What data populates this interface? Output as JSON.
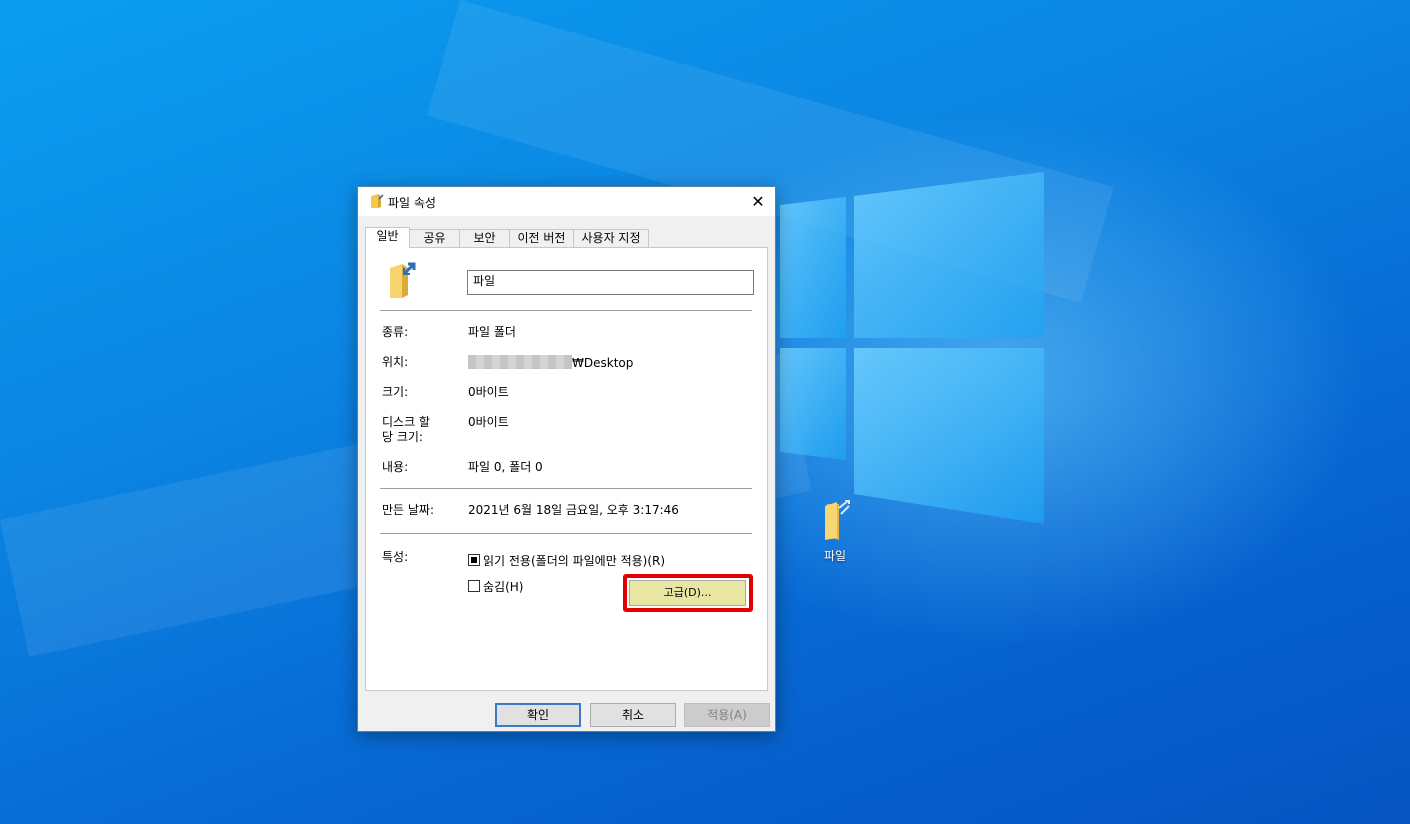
{
  "dialog": {
    "title": "파일 속성",
    "close_label": "✕",
    "tabs": [
      {
        "label": "일반"
      },
      {
        "label": "공유"
      },
      {
        "label": "보안"
      },
      {
        "label": "이전 버전"
      },
      {
        "label": "사용자 지정"
      }
    ],
    "name_value": "파일",
    "fields": {
      "type_label": "종류:",
      "type_value": "파일 폴더",
      "location_label": "위치:",
      "location_value": "₩Desktop",
      "size_label": "크기:",
      "size_value": "0바이트",
      "size_on_disk_label_1": "디스크 할",
      "size_on_disk_label_2": "당 크기:",
      "size_on_disk_value": "0바이트",
      "contents_label": "내용:",
      "contents_value": "파일 0, 폴더 0",
      "created_label": "만든 날짜:",
      "created_value": "2021년 6월 18일 금요일, 오후 3:17:46",
      "attributes_label": "특성:"
    },
    "attributes": {
      "readonly_label": "읽기 전용(폴더의 파일에만 적용)(R)",
      "readonly_state": "indeterminate",
      "hidden_label": "숨김(H)",
      "hidden_state": "unchecked",
      "advanced_label": "고급(D)..."
    },
    "buttons": {
      "ok": "확인",
      "cancel": "취소",
      "apply": "적용(A)"
    }
  },
  "desktop": {
    "icon_label": "파일"
  },
  "colors": {
    "highlight": "#e00000",
    "advanced_button": "#e9e6a4",
    "default_button_border": "#3d79c6"
  }
}
